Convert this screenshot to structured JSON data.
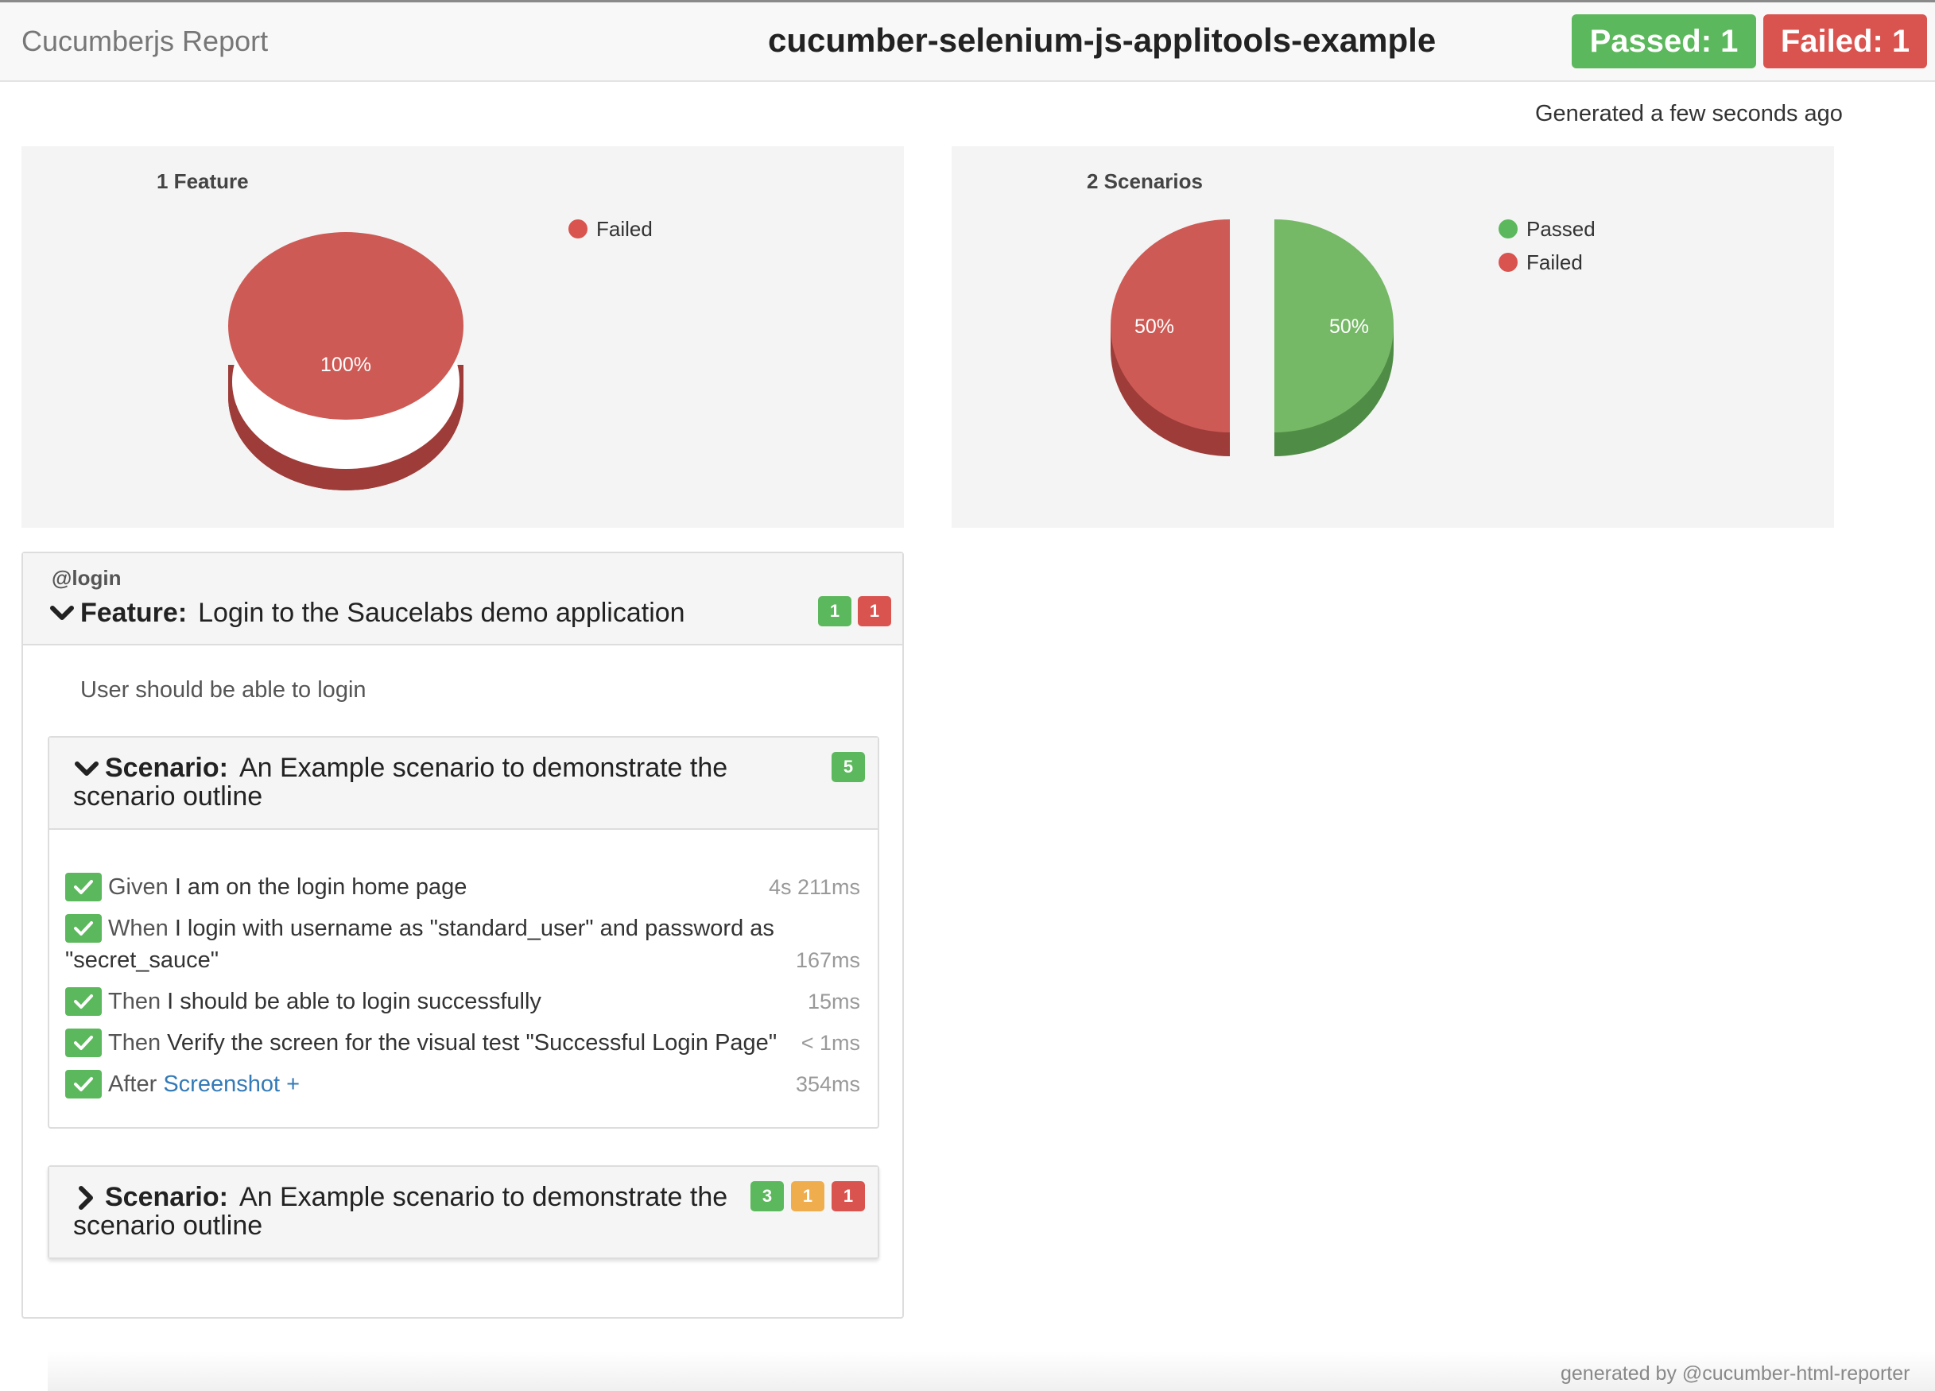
{
  "navbar": {
    "brand": "Cucumberjs Report",
    "project": "cucumber-selenium-js-applitools-example",
    "passed_label": "Passed: 1",
    "failed_label": "Failed: 1"
  },
  "generated": "Generated a few seconds ago",
  "colors": {
    "passed": "#5cb85c",
    "failed": "#d9534f",
    "skipped": "#f0ad4e",
    "link": "#337ab7"
  },
  "chart_data": [
    {
      "type": "pie",
      "title": "1 Feature",
      "categories": [
        "Failed"
      ],
      "values": [
        100
      ],
      "labels": [
        "100%"
      ],
      "colors": [
        "#d9534f"
      ],
      "legend": "top-right"
    },
    {
      "type": "pie",
      "title": "2 Scenarios",
      "categories": [
        "Passed",
        "Failed"
      ],
      "values": [
        50,
        50
      ],
      "labels": [
        "50%",
        "50%"
      ],
      "colors": [
        "#5cb85c",
        "#d9534f"
      ],
      "legend": "top-right"
    }
  ],
  "feature": {
    "tag": "@login",
    "keyword": "Feature:",
    "name": "Login to the Saucelabs demo application",
    "passed_count": "1",
    "failed_count": "1",
    "description": "User should be able to login",
    "icon": "chevron-down-icon"
  },
  "scenarios": [
    {
      "keyword": "Scenario:",
      "name": "An Example scenario to demonstrate the scenario outline",
      "icon": "chevron-down-icon",
      "passed_count": "5",
      "steps": [
        {
          "keyword": "Given",
          "text": " I am on the login home page",
          "duration": "4s 211ms"
        },
        {
          "keyword": "When",
          "text": " I login with username as \"standard_user\" and password as \"secret_sauce\"",
          "duration": "167ms"
        },
        {
          "keyword": "Then",
          "text": " I should be able to login successfully",
          "duration": "15ms"
        },
        {
          "keyword": "Then",
          "text": " Verify the screen for the visual test \"Successful Login Page\"",
          "duration": "< 1ms"
        },
        {
          "keyword": "After",
          "link": "Screenshot +",
          "duration": "354ms"
        }
      ]
    },
    {
      "keyword": "Scenario:",
      "name": "An Example scenario to demonstrate the scenario outline",
      "icon": "chevron-right-icon",
      "passed_count": "3",
      "skipped_count": "1",
      "failed_count": "1"
    }
  ],
  "footer": "generated by @cucumber-html-reporter"
}
